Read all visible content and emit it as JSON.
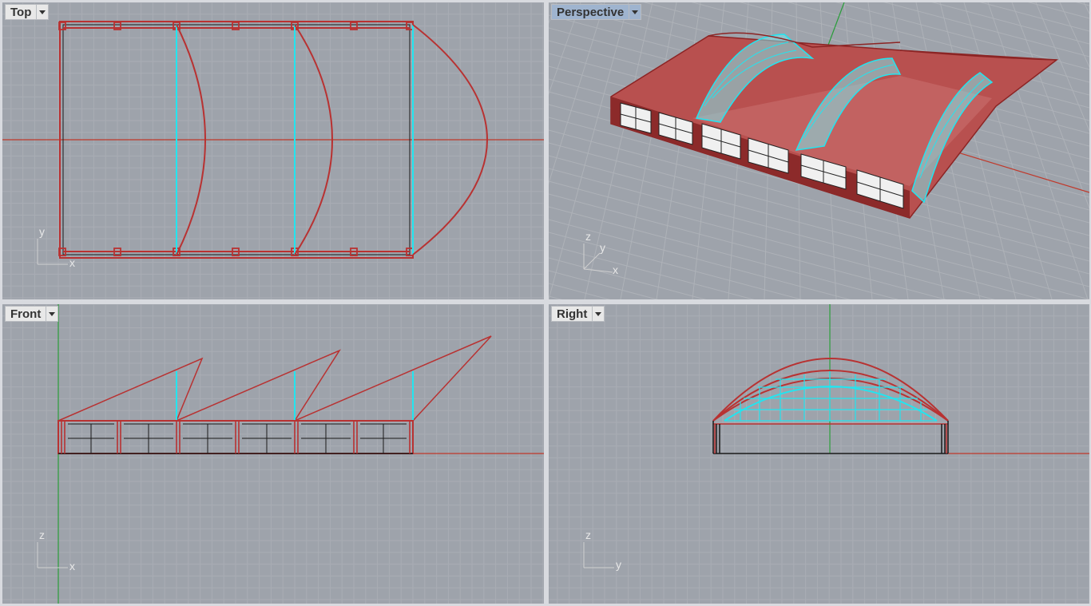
{
  "viewports": [
    {
      "id": "top",
      "label": "Top",
      "active": false,
      "axes": [
        "y",
        "x"
      ]
    },
    {
      "id": "perspective",
      "label": "Perspective",
      "active": true,
      "axes": [
        "z",
        "y",
        "x"
      ]
    },
    {
      "id": "front",
      "label": "Front",
      "active": false,
      "axes": [
        "z",
        "x"
      ]
    },
    {
      "id": "right",
      "label": "Right",
      "active": false,
      "axes": [
        "z",
        "y"
      ]
    }
  ],
  "colors": {
    "background": "#9ea3ab",
    "grid_minor": "#a9adb4",
    "grid_major": "#8e939a",
    "axis_x": "#c0392b",
    "axis_y": "#2a9d3a",
    "model_red": "#b83232",
    "model_cyan": "#22e5f0",
    "glass": "#f2f2f2"
  },
  "icons": [
    "dropdown-arrow-icon"
  ]
}
